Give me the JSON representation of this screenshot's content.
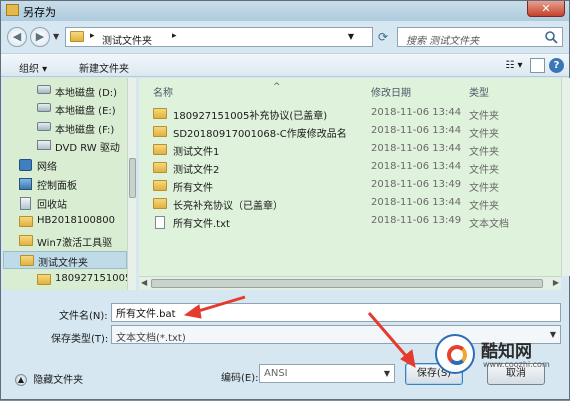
{
  "window": {
    "title": "另存为",
    "close_glyph": "✕"
  },
  "address": {
    "path": "测试文件夹",
    "search_placeholder": "搜索 测试文件夹"
  },
  "toolbar": {
    "organize": "组织 ▾",
    "new_folder": "新建文件夹",
    "view": "☷ ▾",
    "help": "?"
  },
  "nav_pane": {
    "items": [
      {
        "label": "本地磁盘 (D:)",
        "icon": "drive-icon"
      },
      {
        "label": "本地磁盘 (E:)",
        "icon": "drive-icon"
      },
      {
        "label": "本地磁盘 (F:)",
        "icon": "drive-icon"
      },
      {
        "label": "DVD RW 驱动",
        "icon": "dvd-icon"
      },
      {
        "label": "网络",
        "icon": "network-icon"
      },
      {
        "label": "控制面板",
        "icon": "control-panel-icon"
      },
      {
        "label": "回收站",
        "icon": "recycle-bin-icon"
      },
      {
        "label": "HB2018100800",
        "icon": "folder-icon"
      },
      {
        "label": "Win7激活工具驱",
        "icon": "folder-icon"
      },
      {
        "label": "测试文件夹",
        "icon": "folder-icon"
      },
      {
        "label": "180927151005",
        "icon": "folder-icon"
      }
    ]
  },
  "file_list": {
    "headers": {
      "name": "名称",
      "date": "修改日期",
      "type": "类型"
    },
    "rows": [
      {
        "name": "180927151005补充协议(已盖章)",
        "date": "2018-11-06 13:44",
        "type": "文件夹",
        "icon": "folder-icon"
      },
      {
        "name": "SD20180917001068-C作废修改品名",
        "date": "2018-11-06 13:44",
        "type": "文件夹",
        "icon": "folder-icon"
      },
      {
        "name": "测试文件1",
        "date": "2018-11-06 13:44",
        "type": "文件夹",
        "icon": "folder-icon"
      },
      {
        "name": "测试文件2",
        "date": "2018-11-06 13:44",
        "type": "文件夹",
        "icon": "folder-icon"
      },
      {
        "name": "所有文件",
        "date": "2018-11-06 13:49",
        "type": "文件夹",
        "icon": "folder-icon"
      },
      {
        "name": "长亮补充协议（已盖章）",
        "date": "2018-11-06 13:44",
        "type": "文件夹",
        "icon": "folder-icon"
      },
      {
        "name": "所有文件.txt",
        "date": "2018-11-06 13:49",
        "type": "文本文档",
        "icon": "text-file-icon"
      }
    ]
  },
  "form": {
    "filename_label": "文件名(N):",
    "filename_value": "所有文件.bat",
    "savetype_label": "保存类型(T):",
    "savetype_value": "文本文档(*.txt)",
    "encoding_label": "编码(E):",
    "encoding_value": "ANSI",
    "hide_folders": "隐藏文件夹",
    "save_button": "保存(S)",
    "cancel_button": "取消"
  },
  "watermark": {
    "brand": "酷知网",
    "url": "www.coozhi.com"
  },
  "colors": {
    "annotation_arrow": "#e53a2e"
  }
}
